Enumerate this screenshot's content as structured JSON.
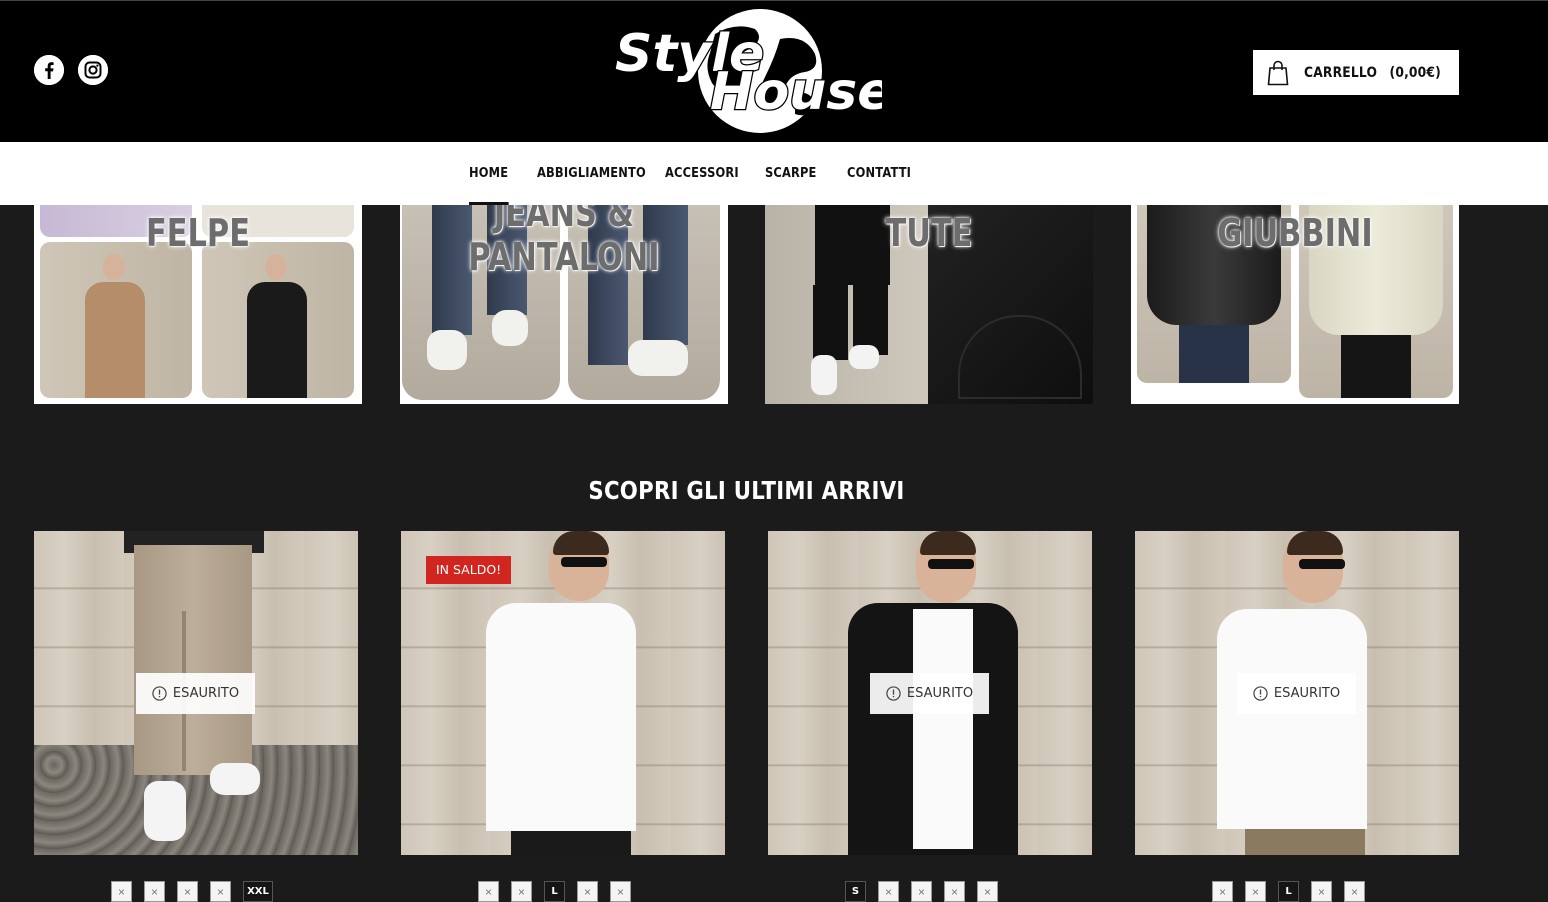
{
  "header": {
    "logo_line1": "Style",
    "logo_line2": "House",
    "cart_label": "CARRELLO",
    "cart_amount": "(0,00€)",
    "social": [
      "facebook-icon",
      "instagram-icon"
    ]
  },
  "nav": {
    "items": [
      {
        "label": "HOME",
        "active": true
      },
      {
        "label": "ABBIGLIAMENTO",
        "active": false
      },
      {
        "label": "ACCESSORI",
        "active": false
      },
      {
        "label": "SCARPE",
        "active": false
      },
      {
        "label": "CONTATTI",
        "active": false
      }
    ]
  },
  "categories": [
    {
      "label": "FELPE"
    },
    {
      "label_line1": "JEANS &",
      "label_line2": "PANTALONI"
    },
    {
      "label": "TUTE"
    },
    {
      "label": "GIUBBINI"
    }
  ],
  "arrivals": {
    "title": "SCOPRI GLI ULTIMI ARRIVI",
    "soldout_label": "ESAURITO",
    "sale_label": "IN SALDO!",
    "products": [
      {
        "soldout": true,
        "sale": false,
        "sizes": [
          "×",
          "×",
          "×",
          "×",
          "XXL"
        ]
      },
      {
        "soldout": false,
        "sale": true,
        "sizes": [
          "×",
          "×",
          "L",
          "×",
          "×"
        ]
      },
      {
        "soldout": true,
        "sale": false,
        "sizes": [
          "S",
          "×",
          "×",
          "×",
          "×"
        ]
      },
      {
        "soldout": true,
        "sale": false,
        "sizes": [
          "×",
          "×",
          "L",
          "×",
          "×"
        ]
      }
    ]
  },
  "colors": {
    "header_bg": "#000000",
    "page_bg": "#1b1b1b",
    "sale_red": "#d0261f"
  }
}
